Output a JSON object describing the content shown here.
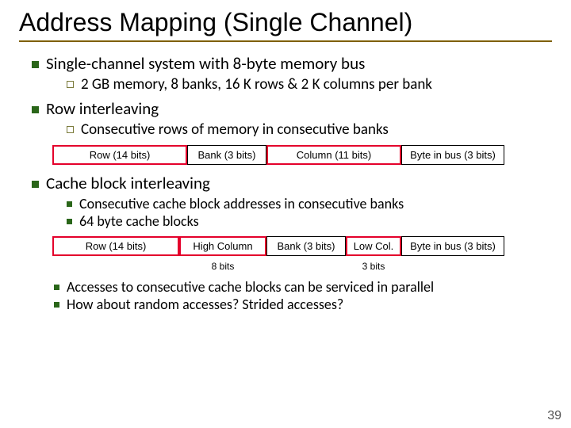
{
  "title": "Address Mapping (Single Channel)",
  "bullets": {
    "b1": "Single-channel system with 8-byte memory bus",
    "b1_1": "2 GB memory, 8 banks, 16 K rows & 2 K columns per bank",
    "b2": "Row interleaving",
    "b2_1": "Consecutive rows of memory in consecutive banks",
    "b3": "Cache block interleaving",
    "b3_1": "Consecutive cache block addresses in consecutive banks",
    "b3_2": "64 byte cache blocks",
    "b3_3": "Accesses to consecutive cache blocks can be serviced in parallel",
    "b3_4": "How about random accesses? Strided accesses?"
  },
  "diagram1": {
    "c1": "Row (14 bits)",
    "c2": "Bank (3 bits)",
    "c3": "Column (11 bits)",
    "c4": "Byte in bus (3 bits)"
  },
  "diagram2": {
    "c1": "Row (14 bits)",
    "c2": "High Column",
    "c3": "Bank (3 bits)",
    "c4": "Low Col.",
    "c5": "Byte in bus (3 bits)",
    "l2": "8 bits",
    "l4": "3 bits"
  },
  "page": "39"
}
